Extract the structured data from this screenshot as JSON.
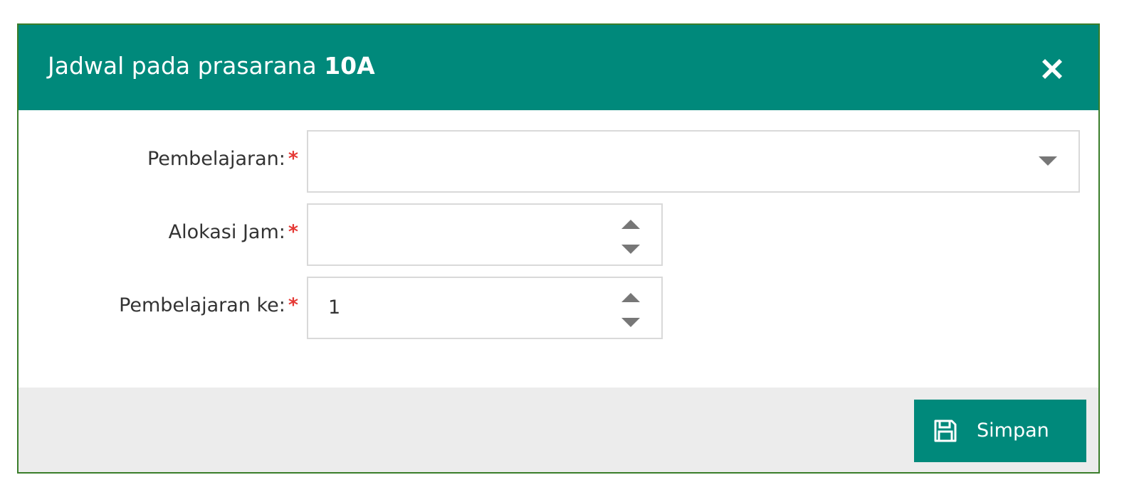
{
  "dialog": {
    "title_prefix": "Jadwal pada prasarana",
    "title_room": "10A",
    "close_icon": "close-icon"
  },
  "form": {
    "pembelajaran": {
      "label": "Pembelajaran:",
      "required_mark": "*",
      "value": ""
    },
    "alokasi_jam": {
      "label": "Alokasi Jam:",
      "required_mark": "*",
      "value": ""
    },
    "pembelajaran_ke": {
      "label": "Pembelajaran ke:",
      "required_mark": "*",
      "value": "1"
    }
  },
  "footer": {
    "save_label": "Simpan",
    "save_icon": "floppy-disk-icon"
  },
  "colors": {
    "header_bg": "#00897b",
    "button_bg": "#00897b",
    "required": "#e53935",
    "footer_bg": "#ececec",
    "border": "#3a7d2a"
  }
}
